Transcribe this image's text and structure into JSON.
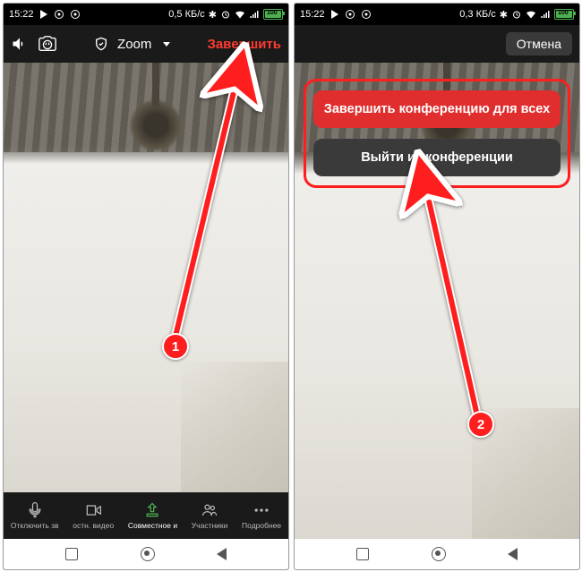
{
  "status": {
    "time": "15:22",
    "data_rate_left": "0,5 КБ/с",
    "data_rate_right": "0,3 КБ/с",
    "battery": "100"
  },
  "zoom_top_left": {
    "app_label": "Zoom",
    "end_label": "Завершить"
  },
  "zoom_top_right": {
    "cancel_label": "Отмена"
  },
  "bottom_bar": {
    "mute": "Отключить зв",
    "video": "остн. видео",
    "share": "Совместное и",
    "participants": "Участники",
    "more": "Подробнее"
  },
  "modal": {
    "end_all": "Завершить конференцию для всех",
    "leave": "Выйти из конференции"
  },
  "annotations": {
    "step1": "1",
    "step2": "2"
  }
}
